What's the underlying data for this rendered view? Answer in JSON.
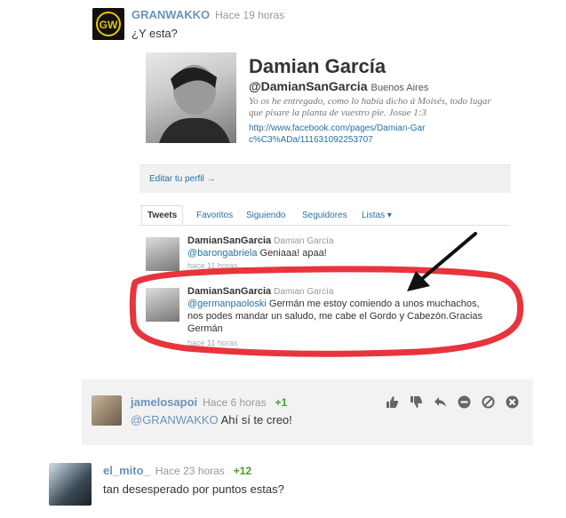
{
  "comments": [
    {
      "username": "GRANWAKKO",
      "time": "Hace 19 horas",
      "text": "¿Y esta?",
      "avatar_text": "GW"
    },
    {
      "username": "jamelosapoi",
      "time": "Hace 6 horas",
      "points": "+1",
      "mention": "@GRANWAKKO",
      "text": " Ahí sí te creo!"
    },
    {
      "username": "el_mito_",
      "time": "Hace 23 horas",
      "points": "+12",
      "text": "tan desesperado por puntos estas?"
    }
  ],
  "twitter": {
    "name": "Damian García",
    "handle": "@DamianSanGarcia",
    "location": "Buenos Aires",
    "bio": "Yo os he entregado, como lo había dicho á Moisés, todo lugar que pisare la planta de vuestro pie. Josue 1:3",
    "url": "http://www.facebook.com/pages/Damian-Garc%C3%ADa/111631092253707",
    "edit_profile": "Editar tu perfil →",
    "tabs": [
      "Tweets",
      "Favoritos",
      "Siguiendo",
      "Seguidores",
      "Listas ▾"
    ],
    "tweets": [
      {
        "user": "DamianSanGarcia",
        "fullname": "Damian García",
        "mention": "@barongabriela",
        "text": " Geniaaa!   apaa!",
        "ago": "hace 11 horas"
      },
      {
        "user": "DamianSanGarcia",
        "fullname": "Damian García",
        "mention": "@germanpaoloski",
        "text": " Germán  me estoy comiendo a unos muchachos, nos podes mandar un saludo, me  cabe el Gordo y Cabezón.Gracias Germán",
        "ago": "hace 11 horas"
      }
    ]
  },
  "colors": {
    "username": "#6c93b8",
    "points": "#4a9a2e",
    "highlight": "#e8343d",
    "link": "#2a6f9e"
  },
  "icons": [
    "thumbs-up-icon",
    "thumbs-down-icon",
    "reply-icon",
    "minus-circle-icon",
    "block-icon",
    "close-circle-icon"
  ]
}
